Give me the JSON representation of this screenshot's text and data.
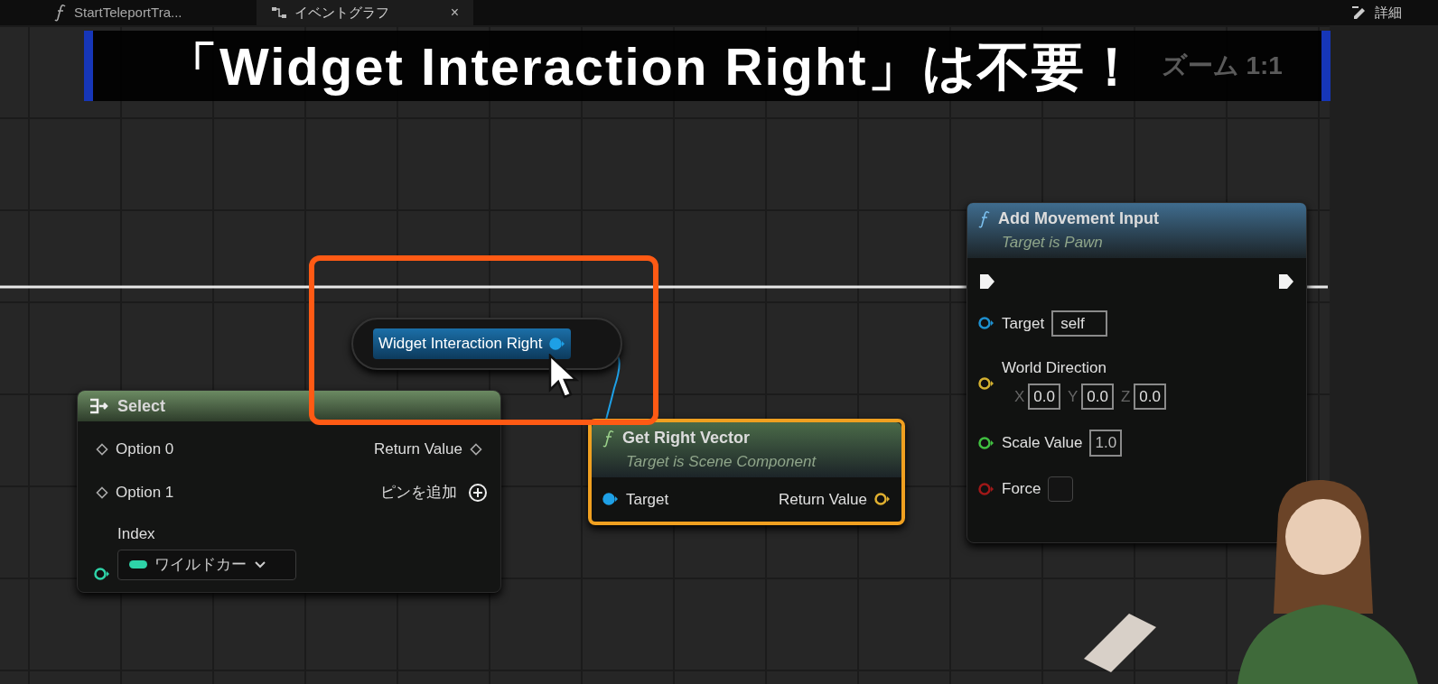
{
  "tabs": [
    {
      "label": "StartTeleportTra...",
      "kind": "function",
      "selected": false
    },
    {
      "label": "イベントグラフ",
      "kind": "graph",
      "selected": true,
      "close": "×"
    }
  ],
  "details_tab": {
    "label": "詳細"
  },
  "zoom_label": "ズーム 1:1",
  "caption": "「Widget Interaction Right」は不要！",
  "nodes": [
    {
      "kind": "variable",
      "label": "Widget Interaction Right",
      "pin": {
        "color": "#1ea0e6",
        "connected": true
      }
    },
    {
      "kind": "select",
      "title": "Select",
      "selected": false,
      "options": [
        {
          "label": "Option 0"
        },
        {
          "label": "Option 1"
        }
      ],
      "output": "Return Value",
      "add_pin": "ピンを追加",
      "index": {
        "label": "Index",
        "value": "ワイルドカー",
        "color": "#2ed3a8"
      }
    },
    {
      "kind": "function",
      "title": "Get Right Vector",
      "subtitle": "Target is Scene Component",
      "selected": true,
      "color": "#4a6a48",
      "exec": false,
      "inputs": [
        {
          "kind": "object",
          "label": "Target",
          "color": "#1ea0e6",
          "connected": true
        }
      ],
      "outputs": [
        {
          "label": "Return Value",
          "color": "#e0b030",
          "connected": false
        }
      ]
    },
    {
      "kind": "function",
      "title": "Add Movement Input",
      "subtitle": "Target is Pawn",
      "selected": false,
      "color": "#3f6c8e",
      "exec": true,
      "inputs": [
        {
          "kind": "object",
          "label": "Target",
          "color": "#1e90d0",
          "connected": false,
          "value": "self"
        },
        {
          "kind": "vector",
          "label": "World Direction",
          "color": "#d4b030",
          "connected": false,
          "components": [
            {
              "axis": "X",
              "value": "0.0"
            },
            {
              "axis": "Y",
              "value": "0.0"
            },
            {
              "axis": "Z",
              "value": "0.0"
            }
          ]
        },
        {
          "kind": "float",
          "label": "Scale Value",
          "color": "#40c040",
          "connected": false,
          "value": "1.0"
        },
        {
          "kind": "bool",
          "label": "Force",
          "color": "#a01818",
          "connected": false,
          "checked": false
        }
      ]
    }
  ]
}
